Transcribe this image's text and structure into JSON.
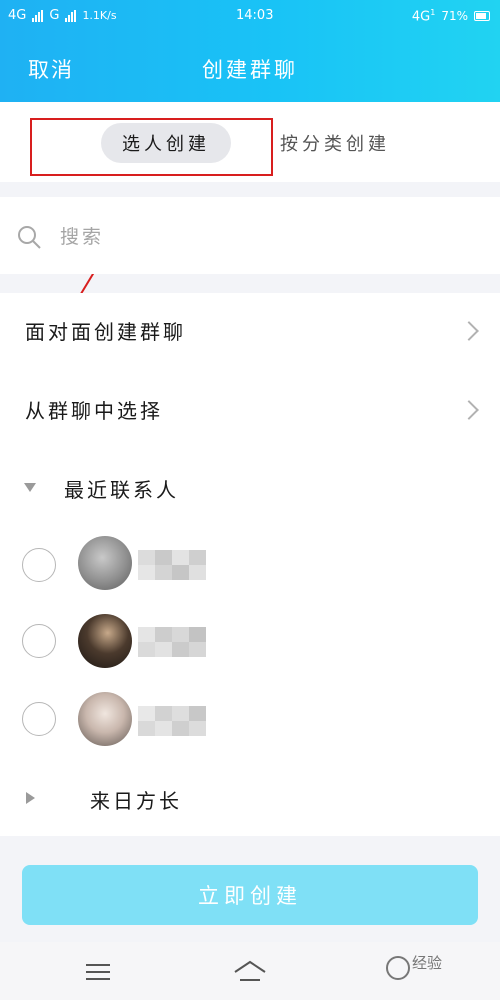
{
  "status_bar": {
    "net1": "4G",
    "net2": "G",
    "speed": "1.1K/s",
    "time": "14:03",
    "net3": "4G",
    "net3_sub": "1",
    "battery": "71%"
  },
  "header": {
    "cancel_label": "取消",
    "title": "创建群聊"
  },
  "mode_tabs": {
    "selected": "选人创建",
    "other": "按分类创建"
  },
  "search": {
    "placeholder": "搜索"
  },
  "list": {
    "face_to_face": "面对面创建群聊",
    "from_group": "从群聊中选择",
    "recent_group": "最近联系人",
    "collapsed_group": "来日方长"
  },
  "actions": {
    "create_label": "立即创建"
  },
  "watermark": {
    "text": "经验"
  },
  "colors": {
    "header_start": "#1fb1f3",
    "header_end": "#21d3f2",
    "create_button": "#7fe0f6",
    "highlight_box": "#d81e1e"
  },
  "icons": {
    "search": "search-icon",
    "chevron": "chevron-right-icon",
    "expanded": "triangle-down-icon",
    "collapsed": "triangle-right-icon",
    "menu": "menu-icon",
    "home": "home-icon",
    "back": "back-icon"
  }
}
